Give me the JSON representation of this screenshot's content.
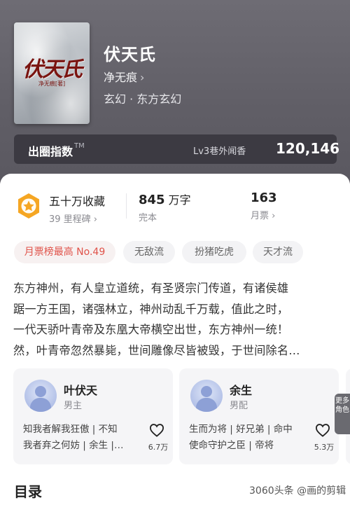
{
  "book": {
    "title": "伏天氏",
    "author": "净无痕",
    "author_chevron": "›",
    "genre": "玄幻 · 东方玄幻",
    "cover_title": "伏天氏",
    "cover_author": "净无痕[著]"
  },
  "index": {
    "label": "出圈指数",
    "tm": "TM",
    "level": "Lv3巷外闻香",
    "score": "120,146",
    "chevron": "›"
  },
  "stats": {
    "collect": {
      "title": "五十万收藏",
      "sub": "39 里程碑 ›"
    },
    "words": {
      "number": "845",
      "unit": "万字",
      "sub": "完本"
    },
    "tickets": {
      "number": "163",
      "sub": "月票 ›"
    }
  },
  "tags": [
    "月票榜最高 No.49",
    "无敌流",
    "扮猪吃虎",
    "天才流"
  ],
  "description": [
    "东方神州，有人皇立道统，有圣贤宗门传道，有诸侯雄",
    "踞一方王国，诸强林立，神州动乱千万载，值此之时，",
    "一代天骄叶青帝及东凰大帝横空出世，东方神州一统！",
    "然，叶青帝忽然暴毙，世间雕像尽皆被毁，于世间除名…"
  ],
  "roles": [
    {
      "name": "叶伏天",
      "role": "男主",
      "quote": [
        "知我者解我狂傲 | 不知",
        "我者弃之何妨 | 余生 |…"
      ],
      "likes": "6.7万"
    },
    {
      "name": "余生",
      "role": "男配",
      "quote": [
        "生而为将 | 好兄弟 | 命中",
        "使命守护之臣 | 帝将"
      ],
      "likes": "5.3万"
    }
  ],
  "more_roles": "更多角色",
  "toc_title": "目录",
  "watermark": "3060头条 @画的剪辑",
  "colors": {
    "accent_red": "#e0534a",
    "badge_orange": "#f5a623",
    "header_bg": "#6e6c74"
  }
}
